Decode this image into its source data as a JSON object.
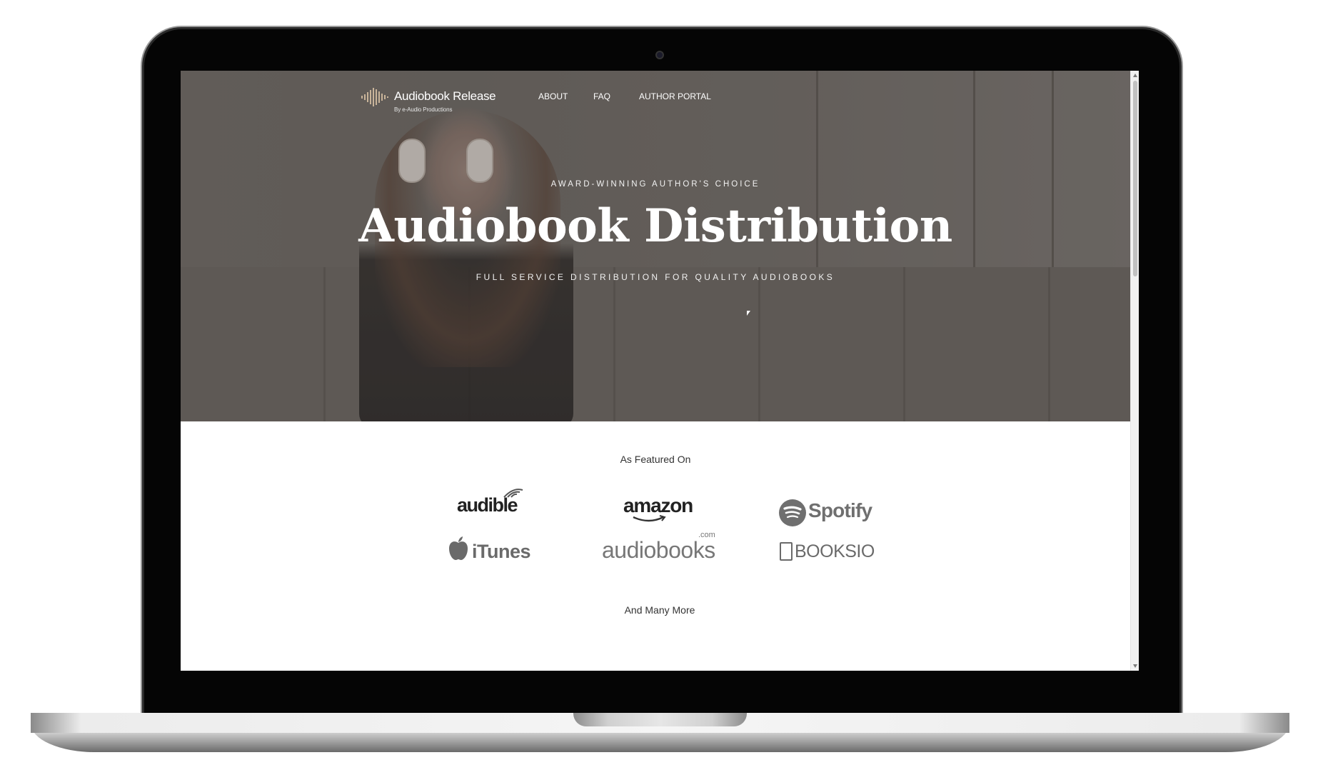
{
  "site": {
    "brand_name": "Audiobook Release",
    "brand_sub": "By e-Audio Productions"
  },
  "nav": {
    "items": [
      "ABOUT",
      "FAQ",
      "AUTHOR PORTAL"
    ]
  },
  "hero": {
    "eyebrow": "AWARD-WINNING AUTHOR'S CHOICE",
    "title": "Audiobook Distribution",
    "subtitle": "FULL SERVICE DISTRIBUTION FOR QUALITY AUDIOBOOKS"
  },
  "featured": {
    "heading": "As Featured On",
    "logos": [
      "audible",
      "amazon",
      "Spotify",
      "iTunes",
      "audiobooks",
      "BOOKSIO"
    ],
    "audiobooks_suffix": ".com",
    "footer": "And Many More"
  },
  "icons": {
    "brand": "soundwave-icon",
    "cursor": "mouse-cursor-icon"
  },
  "colors": {
    "hero_text": "#ffffff",
    "logo_gray": "#6a6a6a",
    "brand_icon": "#c9b49a"
  }
}
